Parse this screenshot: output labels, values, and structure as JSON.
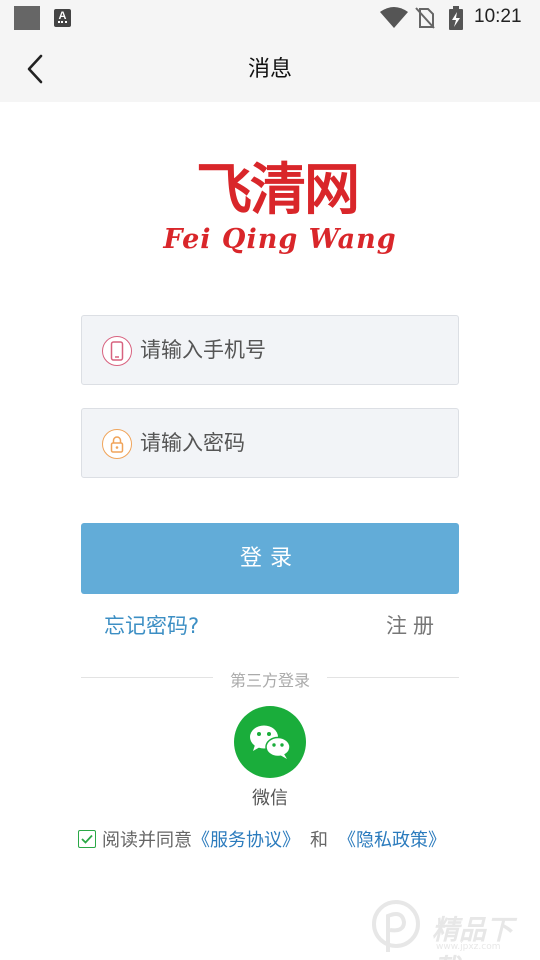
{
  "status_bar": {
    "time": "10:21",
    "app_icon_letter": "A"
  },
  "header": {
    "title": "消息"
  },
  "logo": {
    "chinese": "飞清网",
    "english": "Fei Qing Wang"
  },
  "form": {
    "phone_placeholder": "请输入手机号",
    "password_placeholder": "请输入密码",
    "login_label": "登录",
    "forgot_label": "忘记密码?",
    "register_label": "注册"
  },
  "third_party": {
    "label": "第三方登录",
    "wechat_label": "微信"
  },
  "agreement": {
    "checked": true,
    "prefix": "阅读并同意",
    "service_link": "《服务协议》",
    "and_text": "和",
    "privacy_link": "《隐私政策》"
  },
  "watermark": {
    "text": "精品下载",
    "url": "www.jpxz.com"
  },
  "colors": {
    "brand_red": "#d9262a",
    "login_button": "#62acd8",
    "link_blue": "#3d8fc4",
    "wechat_green": "#1aad3b"
  }
}
